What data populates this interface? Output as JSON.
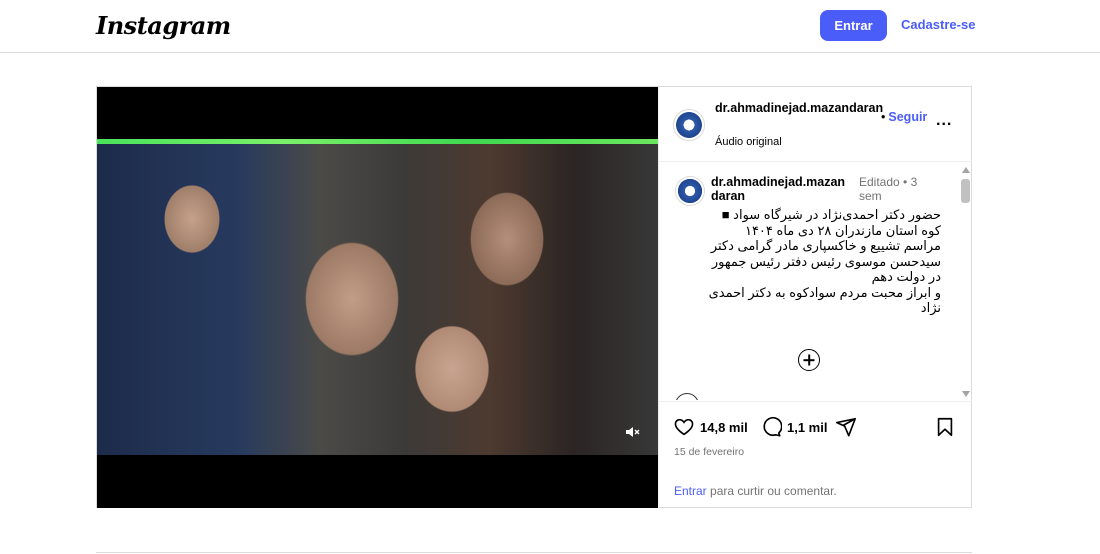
{
  "header": {
    "logo": "Instagram",
    "login_label": "Entrar",
    "signup_label": "Cadastre-se"
  },
  "post": {
    "username": "dr.ahmadinejad.mazandaran",
    "follow_label": "Seguir",
    "follow_separator": "•",
    "audio": "Áudio original",
    "more_label": "...",
    "caption": {
      "username": "dr.ahmadinejad.mazandaran",
      "meta": "Editado • 3 sem",
      "text": "حضور دکتر احمدی‌نژاد در شیرگاه سواد ■ کوه استان مازندران  ۲۸ دی ماه ۱۴۰۴ مراسم تشییع و خاکسپاری مادر گرامی دکتر سیدحسن موسوی رئیس دفتر رئیس جمهور در دولت دهم\nو ابراز محبت مردم سوادکوه به دکتر احمدی نژاد"
    },
    "likes": "14,8 mil",
    "comments": "1,1 mil",
    "date": "15 de fevereiro",
    "login_prompt": {
      "link": "Entrar",
      "text": " para curtir ou comentar."
    }
  },
  "colors": {
    "accent": "#4a5df9",
    "border": "#dbdbdb",
    "muted_text": "#737373"
  },
  "icons": [
    "mute-icon",
    "more-icon",
    "plus-circle-icon",
    "heart-icon",
    "comment-icon",
    "share-icon",
    "bookmark-icon"
  ]
}
